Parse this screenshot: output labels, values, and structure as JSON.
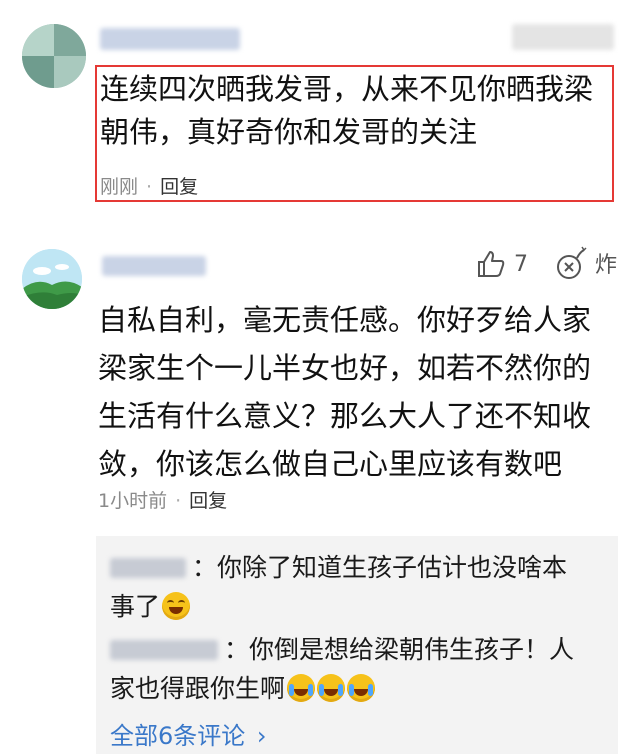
{
  "comment1": {
    "text": "连续四次晒我发哥，从来不见你晒我梁朝伟，真好奇你和发哥的关注",
    "line1": "连续四次晒我发哥，从来不见你晒我梁",
    "line2": "朝伟，真好奇你和发哥的关注",
    "time": "刚刚",
    "reply_label": "回复",
    "highlight_color": "#e53935"
  },
  "comment2": {
    "line1": "自私自利，毫无责任感。你好歹给人家",
    "line2": "梁家生个一儿半女也好，如若不然你的",
    "line3": "生活有什么意义？那么大人了还不知收",
    "line4": "敛，你该怎么做自己心里应该有数吧",
    "time": "1小时前",
    "reply_label": "回复",
    "like_count": "7",
    "bomb_label": "炸",
    "icons": {
      "like": "thumbs-up-icon",
      "bomb": "bomb-icon"
    }
  },
  "replies": [
    {
      "colon": "：",
      "line1": "你除了知道生孩子估计也没啥本",
      "line2": "事了",
      "emoji": "laugh"
    },
    {
      "colon": "：",
      "line1": "你倒是想给梁朝伟生孩子！人",
      "line2": "家也得跟你生啊",
      "emoji": "cry"
    }
  ],
  "more_replies": "全部6条评论",
  "more_chevron": "›",
  "colors": {
    "link": "#3a78c9",
    "meta": "#8a8a8a",
    "reply_box_bg": "#f3f3f3"
  }
}
